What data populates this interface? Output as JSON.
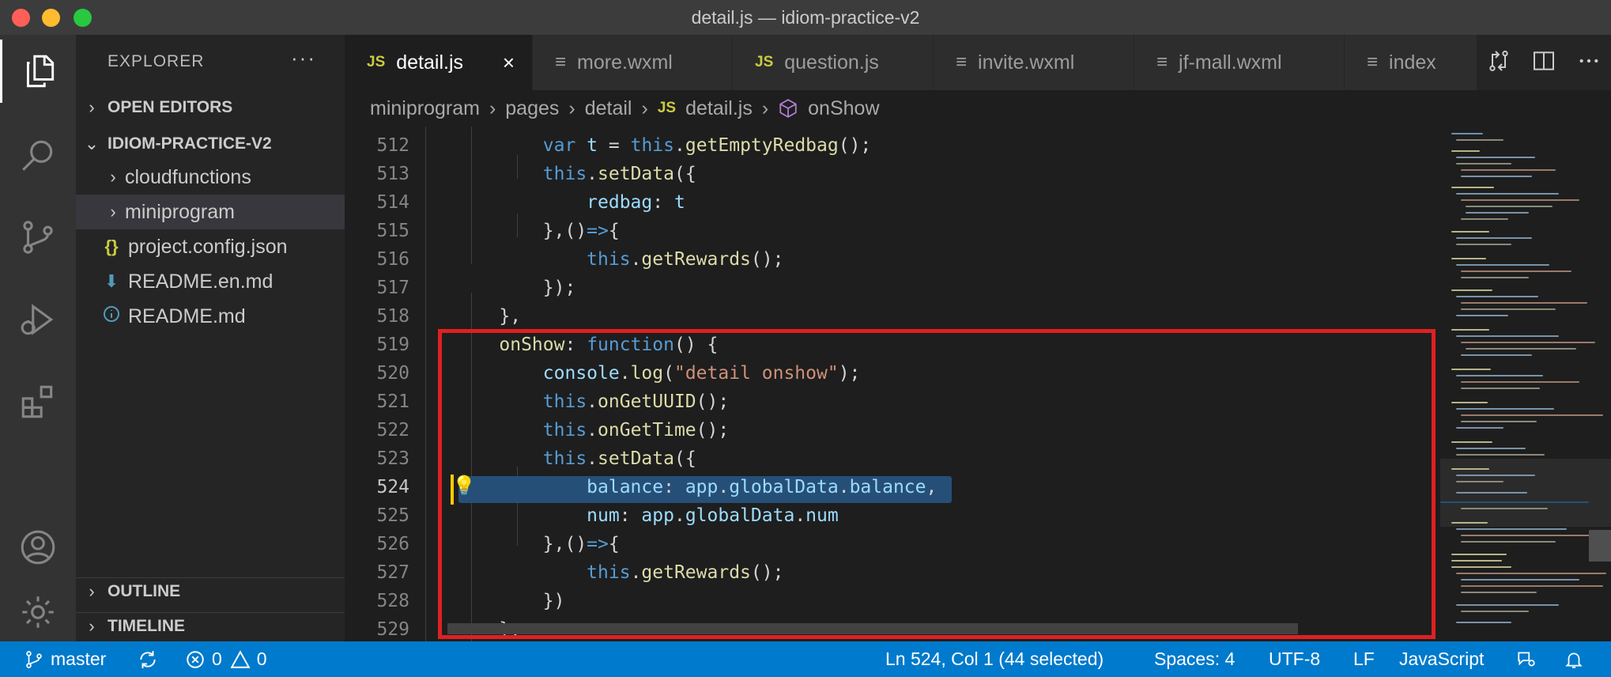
{
  "window": {
    "title": "detail.js — idiom-practice-v2"
  },
  "sidebar": {
    "header": "EXPLORER",
    "more": "···",
    "open_editors": "OPEN EDITORS",
    "project": "IDIOM-PRACTICE-V2",
    "items": [
      {
        "label": "cloudfunctions",
        "type": "folder"
      },
      {
        "label": "miniprogram",
        "type": "folder"
      },
      {
        "label": "project.config.json",
        "type": "json"
      },
      {
        "label": "README.en.md",
        "type": "markdown"
      },
      {
        "label": "README.md",
        "type": "info"
      }
    ],
    "outline": "OUTLINE",
    "timeline": "TIMELINE"
  },
  "tabs": [
    {
      "label": "detail.js",
      "icon": "JS"
    },
    {
      "label": "more.wxml",
      "icon": "≡"
    },
    {
      "label": "question.js",
      "icon": "JS"
    },
    {
      "label": "invite.wxml",
      "icon": "≡"
    },
    {
      "label": "jf-mall.wxml",
      "icon": "≡"
    },
    {
      "label": "index",
      "icon": "≡"
    }
  ],
  "breadcrumb": [
    "miniprogram",
    "pages",
    "detail",
    "detail.js",
    "onShow"
  ],
  "editor": {
    "line_numbers": [
      "512",
      "513",
      "514",
      "515",
      "516",
      "517",
      "518",
      "519",
      "520",
      "521",
      "522",
      "523",
      "524",
      "525",
      "526",
      "527",
      "528",
      "529"
    ],
    "current_line": "524"
  },
  "statusbar": {
    "branch": "master",
    "errors": "0",
    "warnings": "0",
    "position": "Ln 524, Col 1 (44 selected)",
    "spaces": "Spaces: 4",
    "encoding": "UTF-8",
    "eol": "LF",
    "language": "JavaScript"
  },
  "colors": {
    "statusbar": "#007acc",
    "highlight_box": "#e02020",
    "selection": "#264f78",
    "keyword": "#569cd6",
    "function": "#dcdcaa",
    "property": "#9cdcfe",
    "string": "#ce9178"
  }
}
